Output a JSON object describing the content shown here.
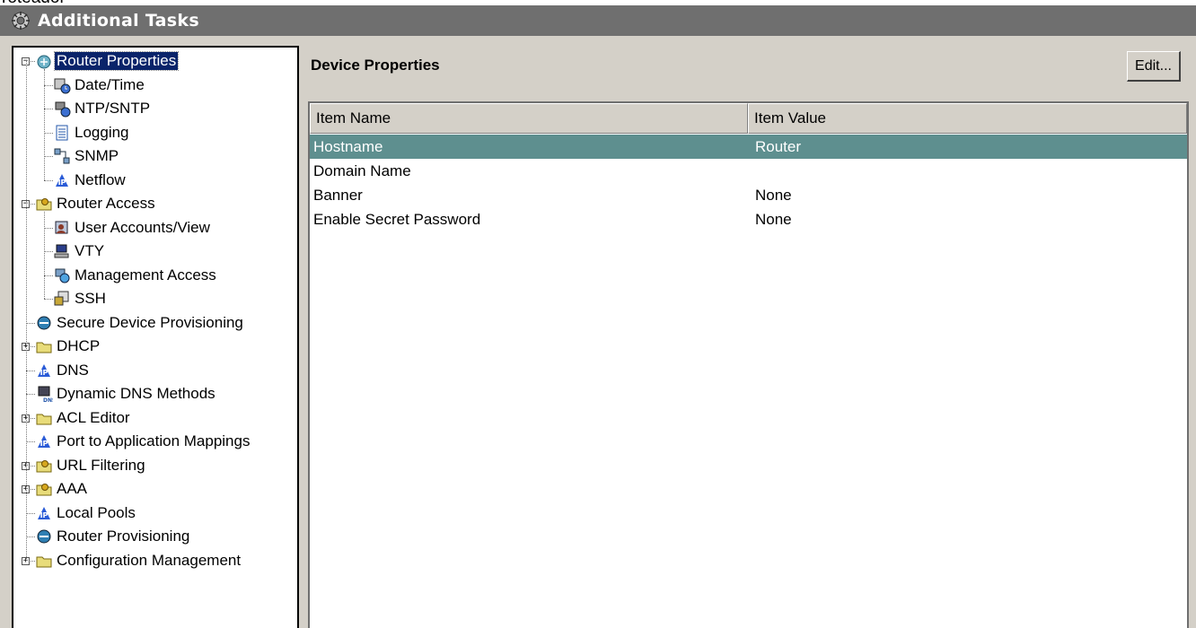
{
  "header": {
    "partial_text": "roteador",
    "title": "Additional Tasks"
  },
  "tree": {
    "items": [
      {
        "label": "Router Properties",
        "icon": "router-icon",
        "selected": true,
        "expander": "minus"
      },
      {
        "label": "Date/Time",
        "icon": "clock-icon"
      },
      {
        "label": "NTP/SNTP",
        "icon": "network-time-icon"
      },
      {
        "label": "Logging",
        "icon": "log-icon"
      },
      {
        "label": "SNMP",
        "icon": "snmp-icon"
      },
      {
        "label": "Netflow",
        "icon": "ip-icon"
      },
      {
        "label": "Router Access",
        "icon": "folder-lock-icon",
        "expander": "minus"
      },
      {
        "label": "User Accounts/View",
        "icon": "user-accounts-icon"
      },
      {
        "label": "VTY",
        "icon": "terminal-icon"
      },
      {
        "label": "Management Access",
        "icon": "management-icon"
      },
      {
        "label": "SSH",
        "icon": "ssh-icon"
      },
      {
        "label": "Secure Device Provisioning",
        "icon": "provisioning-icon"
      },
      {
        "label": "DHCP",
        "icon": "folder-icon",
        "expander": "plus"
      },
      {
        "label": "DNS",
        "icon": "ip-icon"
      },
      {
        "label": "Dynamic DNS Methods",
        "icon": "dns-icon"
      },
      {
        "label": "ACL Editor",
        "icon": "folder-icon",
        "expander": "plus"
      },
      {
        "label": "Port to Application Mappings",
        "icon": "ip-icon"
      },
      {
        "label": "URL Filtering",
        "icon": "folder-lock-icon",
        "expander": "plus"
      },
      {
        "label": "AAA",
        "icon": "folder-lock-icon",
        "expander": "plus"
      },
      {
        "label": "Local Pools",
        "icon": "ip-icon"
      },
      {
        "label": "Router Provisioning",
        "icon": "provisioning-icon"
      },
      {
        "label": "Configuration Management",
        "icon": "folder-icon",
        "expander": "plus"
      }
    ]
  },
  "main": {
    "section_title": "Device Properties",
    "edit_label": "Edit...",
    "table": {
      "columns": [
        "Item Name",
        "Item Value"
      ],
      "rows": [
        {
          "name": "Hostname",
          "value": "Router",
          "selected": true
        },
        {
          "name": "Domain Name",
          "value": ""
        },
        {
          "name": "Banner",
          "value": "None"
        },
        {
          "name": "Enable Secret Password",
          "value": "None"
        }
      ]
    }
  },
  "colors": {
    "title_bar": "#6f6f6f",
    "panel_bg": "#d4d0c8",
    "tree_selection": "#0a246a",
    "table_selection": "#5e8f8f"
  }
}
